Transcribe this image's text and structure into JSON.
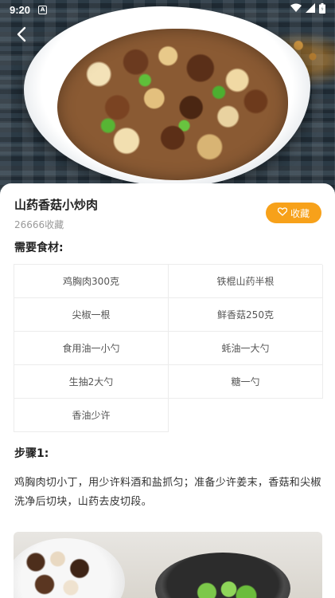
{
  "status_bar": {
    "time": "9:20",
    "notification_icon_letter": "A"
  },
  "recipe": {
    "title": "山药香菇小炒肉",
    "favorite_count": "26666收藏",
    "favorite_button_label": "收藏"
  },
  "ingredients": {
    "label": "需要食材:",
    "items": [
      "鸡胸肉300克",
      "铁棍山药半根",
      "尖椒一根",
      "鲜香菇250克",
      "食用油一小勺",
      "蚝油一大勺",
      "生抽2大勺",
      "糖一勺",
      "香油少许"
    ]
  },
  "steps": [
    {
      "label": "步骤1:",
      "text": "鸡胸肉切小丁，用少许料酒和盐抓匀；准备少许姜末，香菇和尖椒洗净后切块，山药去皮切段。"
    }
  ],
  "colors": {
    "accent": "#f7a11a"
  },
  "icons": {
    "back": "chevron-left-icon",
    "favorite": "heart-outline-icon",
    "wifi": "wifi-icon",
    "signal": "cell-signal-icon",
    "battery": "battery-icon"
  }
}
